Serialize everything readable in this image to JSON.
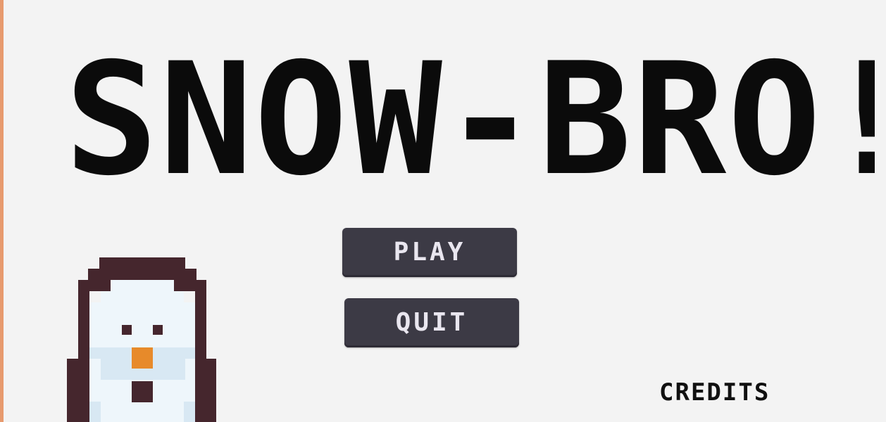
{
  "menu": {
    "title": "SNOW-BRO!",
    "play_label": "PLAY",
    "quit_label": "QUIT",
    "credits_label": "CREDITS"
  },
  "colors": {
    "background": "#f3f3f3",
    "title": "#0b0b0b",
    "button_bg": "#3c3a45",
    "button_text": "#e9e6ef",
    "snowman_outline": "#45262d",
    "snowman_body": "#eef6fb",
    "snowman_shadow": "#d8e8f3",
    "carrot_nose": "#e78a2a"
  },
  "sprites": {
    "character": "snowman-sprite"
  }
}
